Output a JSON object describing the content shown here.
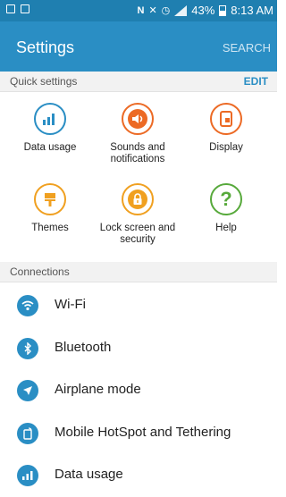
{
  "status_bar": {
    "battery": "43%",
    "time": "8:13 AM",
    "icons": [
      "notification-icon",
      "image-icon",
      "nfc-icon",
      "mute-icon",
      "alarm-icon",
      "signal-icon",
      "battery-icon"
    ]
  },
  "app_bar": {
    "title": "Settings",
    "search_label": "SEARCH"
  },
  "quick_settings": {
    "header": "Quick settings",
    "edit_label": "EDIT",
    "tiles": [
      {
        "label": "Data usage",
        "icon": "bar-chart-icon",
        "color": "#2a8ec4"
      },
      {
        "label": "Sounds and notifications",
        "icon": "speaker-icon",
        "color": "#ec6a25"
      },
      {
        "label": "Display",
        "icon": "display-icon",
        "color": "#ec6a25"
      },
      {
        "label": "Themes",
        "icon": "paintbrush-icon",
        "color": "#f0a020"
      },
      {
        "label": "Lock screen and security",
        "icon": "lock-icon",
        "color": "#f0a020"
      },
      {
        "label": "Help",
        "icon": "question-icon",
        "color": "#57a93b"
      }
    ]
  },
  "connections": {
    "header": "Connections",
    "items": [
      {
        "label": "Wi-Fi",
        "icon": "wifi-icon"
      },
      {
        "label": "Bluetooth",
        "icon": "bluetooth-icon"
      },
      {
        "label": "Airplane mode",
        "icon": "airplane-icon"
      },
      {
        "label": "Mobile HotSpot and Tethering",
        "icon": "hotspot-icon"
      },
      {
        "label": "Data usage",
        "icon": "bar-chart-icon"
      }
    ]
  },
  "colors": {
    "accent": "#2a8ec4",
    "status_bar": "#1f7fb0"
  }
}
